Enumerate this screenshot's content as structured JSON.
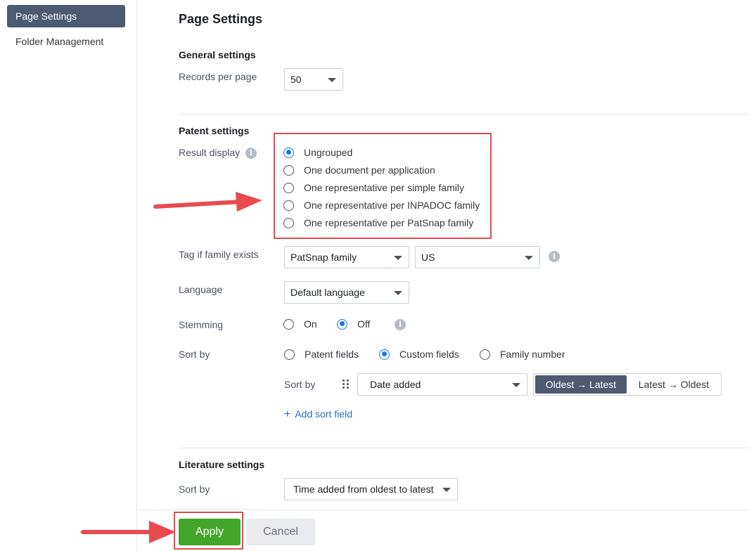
{
  "sidebar": {
    "items": [
      {
        "label": "Page Settings",
        "active": true
      },
      {
        "label": "Folder Management",
        "active": false
      }
    ]
  },
  "main": {
    "title": "Page Settings",
    "general": {
      "title": "General settings",
      "records_label": "Records per page",
      "records_value": "50"
    },
    "patent": {
      "title": "Patent settings",
      "result_display_label": "Result display",
      "result_options": [
        {
          "label": "Ungrouped",
          "selected": true
        },
        {
          "label": "One document per application",
          "selected": false
        },
        {
          "label": "One representative per simple family",
          "selected": false
        },
        {
          "label": "One representative per INPADOC family",
          "selected": false
        },
        {
          "label": "One representative per PatSnap family",
          "selected": false
        }
      ],
      "tag_label": "Tag if family exists",
      "tag_family_value": "PatSnap family",
      "tag_country_value": "US",
      "language_label": "Language",
      "language_value": "Default language",
      "stemming_label": "Stemming",
      "stemming_options": [
        {
          "label": "On",
          "selected": false
        },
        {
          "label": "Off",
          "selected": true
        }
      ],
      "sortby_label": "Sort by",
      "sortby_options": [
        {
          "label": "Patent fields",
          "selected": false
        },
        {
          "label": "Custom fields",
          "selected": true
        },
        {
          "label": "Family number",
          "selected": false
        }
      ],
      "sort_sub_label": "Sort by",
      "sort_field_value": "Date added",
      "order_options": [
        {
          "label": "Oldest → Latest",
          "active": true
        },
        {
          "label": "Latest → Oldest",
          "active": false
        }
      ],
      "add_sort_label": "Add sort field"
    },
    "literature": {
      "title": "Literature settings",
      "sortby_label": "Sort by",
      "sortby_value": "Time added from oldest to latest"
    }
  },
  "footer": {
    "apply_label": "Apply",
    "cancel_label": "Cancel"
  },
  "colors": {
    "accent": "#1a73e8",
    "sidebar_active": "#4c5a72",
    "apply": "#43a52a",
    "annotation": "#e84a4f",
    "link": "#2a6ec4"
  },
  "icons": {
    "info": "info-icon",
    "caret": "caret-down-icon",
    "drag": "drag-handle-icon",
    "add": "plus-icon"
  }
}
